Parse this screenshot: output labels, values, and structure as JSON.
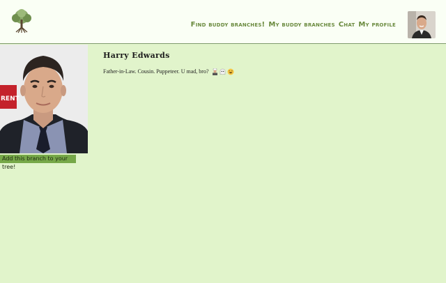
{
  "header": {
    "nav": [
      "Find buddy branches!",
      "My buddy branches",
      "Chat",
      "My profile"
    ]
  },
  "profile": {
    "name": "Harry Edwards",
    "bio": "Father-in-Law. Cousin. Puppeteer. U mad, bro?",
    "bio_icons": [
      "cook-icon",
      "ghost-icon",
      "laughing-face-icon"
    ],
    "photo_sign_text": "RENT",
    "add_button_label": "Add this branch to your tree!"
  },
  "colors": {
    "page_background": "#e1f4cb",
    "header_background": "#fafff5",
    "nav_text": "#6a8a3e",
    "button_background": "#76a848"
  }
}
